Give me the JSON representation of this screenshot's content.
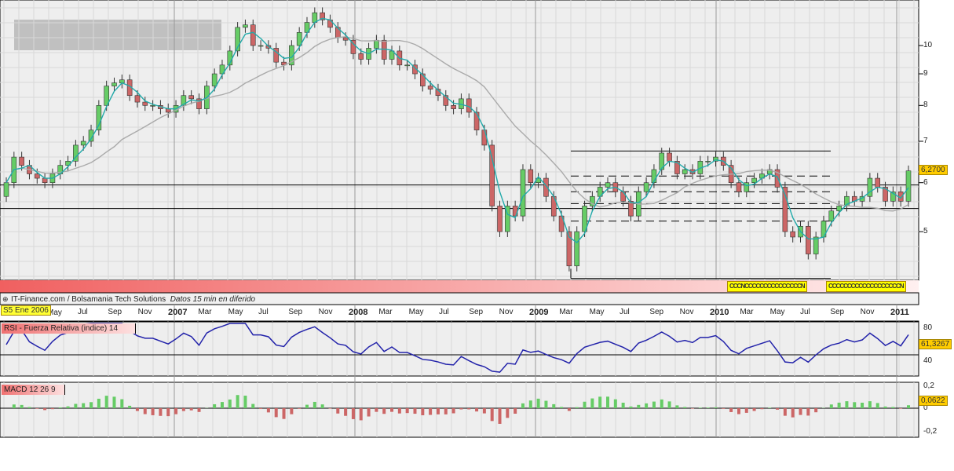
{
  "chart_data": {
    "type": "candlestick",
    "start": "2006-02",
    "interval_weeks": 2,
    "closes": [
      6.0,
      6.6,
      6.4,
      6.2,
      6.1,
      6.0,
      6.2,
      6.4,
      6.5,
      6.9,
      7.0,
      7.3,
      8.0,
      8.6,
      8.7,
      8.8,
      8.3,
      8.1,
      8.0,
      8.0,
      7.9,
      7.8,
      8.0,
      8.3,
      8.2,
      7.9,
      8.6,
      9.0,
      9.3,
      9.8,
      10.7,
      10.8,
      10.0,
      10.0,
      9.9,
      9.4,
      9.3,
      10.0,
      10.5,
      10.9,
      11.3,
      11.0,
      10.7,
      10.3,
      10.2,
      9.7,
      9.5,
      9.9,
      10.2,
      9.5,
      9.8,
      9.3,
      9.3,
      9.0,
      8.6,
      8.5,
      8.3,
      8.0,
      7.9,
      8.2,
      7.8,
      7.3,
      6.9,
      5.5,
      5.0,
      5.5,
      5.3,
      6.3,
      6.0,
      6.1,
      5.7,
      5.3,
      5.0,
      4.4,
      5.0,
      5.5,
      5.7,
      5.9,
      6.0,
      5.8,
      5.6,
      5.3,
      5.8,
      6.0,
      6.3,
      6.7,
      6.5,
      6.2,
      6.3,
      6.2,
      6.5,
      6.5,
      6.6,
      6.4,
      6.0,
      5.8,
      6.0,
      6.1,
      6.2,
      6.3,
      5.9,
      5.0,
      4.9,
      5.1,
      4.6,
      4.9,
      5.2,
      5.4,
      5.5,
      5.7,
      5.6,
      5.7,
      6.1,
      5.9,
      5.6,
      5.8,
      5.6,
      6.27
    ],
    "price_axis": {
      "ticks": [
        "10",
        "9",
        "8",
        "7",
        "6",
        "5"
      ],
      "values": [
        10,
        9,
        8,
        7,
        6,
        5
      ]
    },
    "last_price": "6,2700",
    "horizontal_levels": [
      5.95,
      5.45
    ],
    "channel": {
      "top": 6.75,
      "bottom": 4.2,
      "dashed": [
        6.15,
        5.8,
        5.55,
        5.2
      ]
    },
    "ma_periods": [
      3,
      15
    ],
    "x_labels": [
      {
        "t": "2006-07",
        "text": "Jul"
      },
      {
        "t": "2006-09",
        "text": "Sep"
      },
      {
        "t": "2006-11",
        "text": "Nov"
      },
      {
        "t": "2007-01",
        "text": "2007",
        "year": true
      },
      {
        "t": "2007-03",
        "text": "Mar"
      },
      {
        "t": "2007-05",
        "text": "May"
      },
      {
        "t": "2007-07",
        "text": "Jul"
      },
      {
        "t": "2007-09",
        "text": "Sep"
      },
      {
        "t": "2007-11",
        "text": "Nov"
      },
      {
        "t": "2008-01",
        "text": "2008",
        "year": true
      },
      {
        "t": "2008-03",
        "text": "Mar"
      },
      {
        "t": "2008-05",
        "text": "May"
      },
      {
        "t": "2008-07",
        "text": "Jul"
      },
      {
        "t": "2008-09",
        "text": "Sep"
      },
      {
        "t": "2008-11",
        "text": "Nov"
      },
      {
        "t": "2009-01",
        "text": "2009",
        "year": true
      },
      {
        "t": "2009-03",
        "text": "Mar"
      },
      {
        "t": "2009-05",
        "text": "May"
      },
      {
        "t": "2009-07",
        "text": "Jul"
      },
      {
        "t": "2009-09",
        "text": "Sep"
      },
      {
        "t": "2009-11",
        "text": "Nov"
      },
      {
        "t": "2010-01",
        "text": "2010",
        "year": true
      },
      {
        "t": "2010-03",
        "text": "Mar"
      },
      {
        "t": "2010-05",
        "text": "May"
      },
      {
        "t": "2010-07",
        "text": "Jul"
      },
      {
        "t": "2010-09",
        "text": "Sep"
      },
      {
        "t": "2010-11",
        "text": "Nov"
      },
      {
        "t": "2011-01",
        "text": "2011",
        "year": true
      }
    ],
    "rsi": {
      "title": "RSI - Fuerza Relativa (indice) 14",
      "ticks": [
        "80",
        "40"
      ],
      "last": "61,3267",
      "levels": [
        80,
        40
      ]
    },
    "macd": {
      "title": "MACD 12 26 9",
      "ticks": [
        "0,2",
        "0",
        "-0,2"
      ],
      "last": "0,0622"
    }
  },
  "footer": {
    "source": "IT-Finance.com / Bolsamania Tech Solutions",
    "delay": "Datos 15 min en diferido"
  },
  "cursor_date": "S5 Ene 2006",
  "first_label": "May",
  "signal_strip": [
    "CCCNCCCCCCCCCCCCCCCN",
    "CCCCCCCCCCCCCCCCCCCN"
  ],
  "colors": {
    "up": "#66cc66",
    "down": "#cc6666",
    "ma_fast": "#22aaaa",
    "ma_slow": "#aaaaaa",
    "rsi": "#2222aa",
    "badge": "#ffcc00"
  }
}
